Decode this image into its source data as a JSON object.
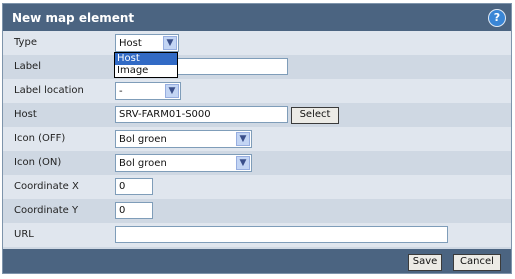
{
  "dialog": {
    "title": "New map element",
    "help_label": "?"
  },
  "fields": {
    "type": {
      "label": "Type",
      "value": "Host",
      "options": [
        "Host",
        "Image"
      ],
      "highlighted": "Host"
    },
    "label": {
      "label": "Label",
      "value": ""
    },
    "label_location": {
      "label": "Label location",
      "value": "-"
    },
    "host": {
      "label": "Host",
      "value": "SRV-FARM01-S000",
      "button": "Select"
    },
    "icon_off": {
      "label": "Icon (OFF)",
      "value": "Bol groen"
    },
    "icon_on": {
      "label": "Icon (ON)",
      "value": "Bol groen"
    },
    "coord_x": {
      "label": "Coordinate X",
      "value": "0"
    },
    "coord_y": {
      "label": "Coordinate Y",
      "value": "0"
    },
    "url": {
      "label": "URL",
      "value": ""
    }
  },
  "footer": {
    "save_label": "Save",
    "cancel_label": "Cancel"
  }
}
